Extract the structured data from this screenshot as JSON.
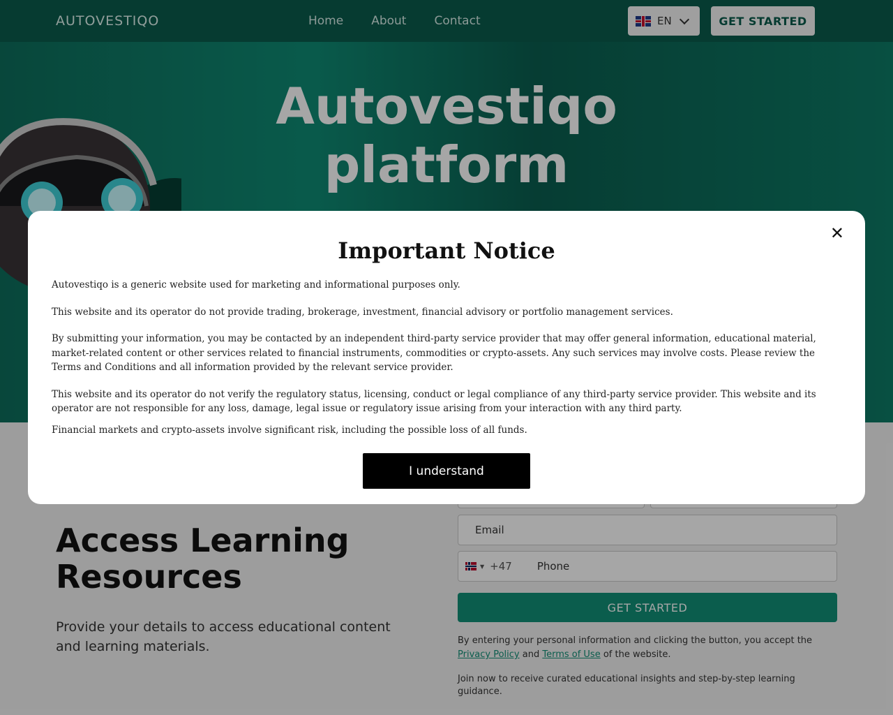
{
  "header": {
    "logo": "AUTOVESTIQO",
    "nav": [
      "Home",
      "About",
      "Contact"
    ],
    "language": "EN",
    "cta": "GET STARTED"
  },
  "hero": {
    "title_line1": "Autovestiqo",
    "title_line2": "platform"
  },
  "section": {
    "title_line1": "Access Learning",
    "title_line2": "Resources",
    "description": "Provide your details to access educational content and learning materials."
  },
  "form": {
    "email_placeholder": "Email",
    "phone_code": "+47",
    "phone_placeholder": "Phone",
    "submit": "GET STARTED",
    "consent_prefix": "By entering your personal information and clicking the button, you accept the ",
    "privacy_link": "Privacy Policy",
    "consent_and": " and ",
    "terms_link": "Terms of Use",
    "consent_suffix": " of the website.",
    "join_text": "Join now to receive curated educational insights and step-by-step learning guidance."
  },
  "modal": {
    "title": "Important Notice",
    "p1": "Autovestiqo is a generic website used for marketing and informational purposes only.",
    "p2": "This website and its operator do not provide trading, brokerage, investment, financial advisory or portfolio management services.",
    "p3": "By submitting your information, you may be contacted by an independent third-party service provider that may offer general information, educational material, market-related content or other services related to financial instruments, commodities or crypto-assets. Any such services may involve costs. Please review the Terms and Conditions and all information provided by the relevant service provider.",
    "p4": "This website and its operator do not verify the regulatory status, licensing, conduct or legal compliance of any third-party service provider. This website and its operator are not responsible for any loss, damage, legal issue or regulatory issue arising from your interaction with any third party.",
    "p5": "Financial markets and crypto-assets involve significant risk, including the possible loss of all funds.",
    "button": "I understand",
    "close_glyph": "✕"
  },
  "colors": {
    "brand": "#0a5b4c",
    "accent": "#128f77"
  }
}
